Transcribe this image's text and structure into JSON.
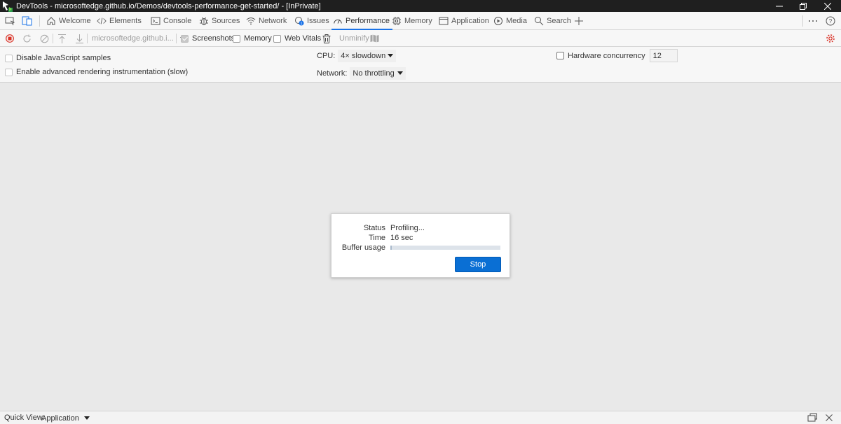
{
  "window": {
    "title": "DevTools - microsoftedge.github.io/Demos/devtools-performance-get-started/ - [InPrivate]",
    "minimize_icon": "minimize-icon",
    "restore_icon": "restore-icon",
    "close_icon": "close-icon"
  },
  "tabs": [
    {
      "label": "Welcome",
      "icon": "home-icon"
    },
    {
      "label": "Elements",
      "icon": "code-icon"
    },
    {
      "label": "Console",
      "icon": "console-icon"
    },
    {
      "label": "Sources",
      "icon": "bug-icon"
    },
    {
      "label": "Network",
      "icon": "wifi-icon"
    },
    {
      "label": "Issues",
      "icon": "issues-icon"
    },
    {
      "label": "Performance",
      "icon": "gauge-icon",
      "active": true
    },
    {
      "label": "Memory",
      "icon": "chip-icon"
    },
    {
      "label": "Application",
      "icon": "window-icon"
    },
    {
      "label": "Media",
      "icon": "play-icon"
    },
    {
      "label": "Search",
      "icon": "search-icon"
    }
  ],
  "toolbar": {
    "origin": "microsoftedge.github.i...",
    "screenshots_label": "Screenshots",
    "screenshots_checked": true,
    "memory_label": "Memory",
    "memory_checked": false,
    "web_vitals_label": "Web Vitals",
    "web_vitals_checked": false,
    "unminify_label": "Unminify"
  },
  "settings": {
    "disable_js_samples": "Disable JavaScript samples",
    "enable_rendering": "Enable advanced rendering instrumentation (slow)",
    "cpu_label": "CPU:",
    "cpu_value": "4× slowdown",
    "network_label": "Network:",
    "network_value": "No throttling",
    "hardware_concurrency_label": "Hardware concurrency",
    "hardware_concurrency_value": "12"
  },
  "profiling": {
    "status_label": "Status",
    "status_value": "Profiling...",
    "time_label": "Time",
    "time_value": "16 sec",
    "buffer_label": "Buffer usage",
    "buffer_fraction": 0.01,
    "stop_label": "Stop"
  },
  "bottom": {
    "quick_view_label": "Quick View:",
    "quick_view_value": "Application"
  },
  "colors": {
    "accent": "#1a73e8",
    "record_red": "#d93025",
    "stop_button": "#0a6fd4",
    "titlebar": "#1f1f1f"
  }
}
